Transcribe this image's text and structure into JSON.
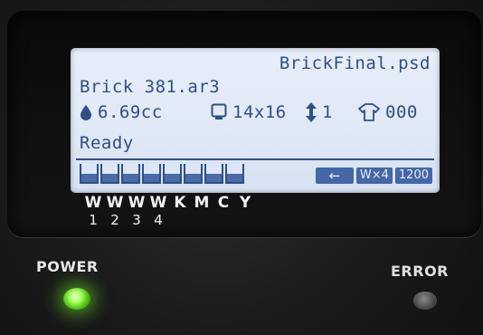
{
  "screen": {
    "file_name": "BrickFinal.psd",
    "job_name": "Brick 381.ar3",
    "ink_volume": "6.69cc",
    "platen_size": "14x16",
    "passes": "1",
    "counter": "000",
    "status": "Ready",
    "ink_levels": [
      0.45,
      0.45,
      0.45,
      0.45,
      0.45,
      0.45,
      0.45,
      0.45
    ],
    "buttons": {
      "back": "←",
      "white_mode": "W×4",
      "resolution": "1200"
    }
  },
  "channels": {
    "letters": [
      "W",
      "W",
      "W",
      "W",
      "K",
      "M",
      "C",
      "Y"
    ],
    "numbers": [
      "1",
      "2",
      "3",
      "4"
    ]
  },
  "indicators": {
    "power_label": "POWER",
    "error_label": "ERROR"
  },
  "colors": {
    "lcd_text": "#2f4f86",
    "power_led": "#6be82a",
    "error_led": "#4d4d4d"
  }
}
